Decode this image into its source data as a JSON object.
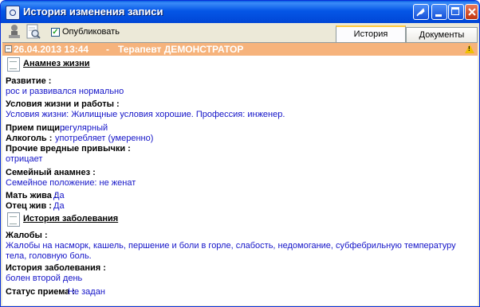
{
  "window": {
    "title": "История изменения записи"
  },
  "toolbar": {
    "publish_label": "Опубликовать",
    "publish_checked": true,
    "tabs": [
      {
        "label": "История",
        "active": true
      },
      {
        "label": "Документы",
        "active": false
      }
    ]
  },
  "record": {
    "date": "26.04.2013 13:44",
    "separator": "-",
    "document": "Терапевт ДЕМОНСТРАТОР"
  },
  "sections": {
    "life": {
      "title": "Анамнез жизни",
      "development_label": "Развитие :",
      "development_value": "рос и развивался нормально",
      "living_label": "Условия жизни и работы :",
      "living_value": "Условия жизни: Жилищные условия хорошие. Профессия: инженер.",
      "food_label": "Прием пищи :",
      "food_value": "регулярный",
      "alcohol_label": "Алкоголь :",
      "alcohol_value": "употребляет (умеренно)",
      "habits_label": "Прочие вредные привычки :",
      "habits_value": "отрицает",
      "family_label": "Семейный анамнез :",
      "family_value": "Семейное положение: не женат",
      "mother_label": "Мать жива :",
      "mother_value": "Да",
      "father_label": "Отец жив :",
      "father_value": "Да"
    },
    "illness": {
      "title": "История заболевания",
      "complaints_label": "Жалобы :",
      "complaints_value": "Жалобы на насморк, кашель, першение и боли в горле, слабость, недомогание, субфебрильную температуру тела, головную боль.",
      "history_label": "История заболевания :",
      "history_value": "болен второй день",
      "status_label": "Статус приема :",
      "status_value": "Не задан"
    }
  },
  "colors": {
    "header_bar": "#f6b37c",
    "value_text": "#1414c8",
    "titlebar": "#0556e6"
  }
}
